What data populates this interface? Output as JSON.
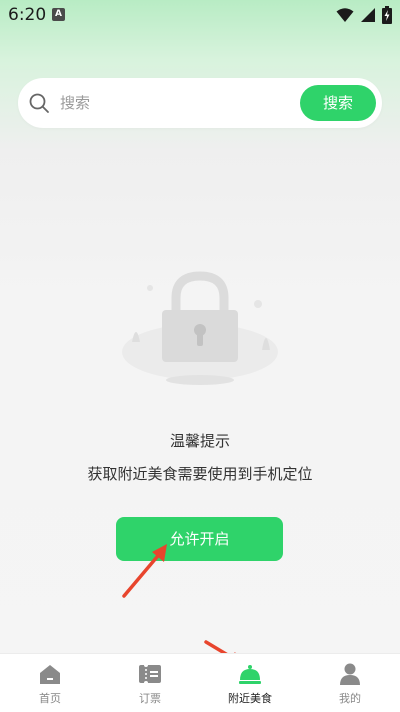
{
  "status_bar": {
    "time": "6:20",
    "notification_icon": "A"
  },
  "search": {
    "placeholder": "搜索",
    "button_label": "搜索"
  },
  "notice": {
    "title": "温馨提示",
    "description": "获取附近美食需要使用到手机定位",
    "button_label": "允许开启"
  },
  "tabs": [
    {
      "label": "首页",
      "icon": "home-icon"
    },
    {
      "label": "订票",
      "icon": "ticket-icon"
    },
    {
      "label": "附近美食",
      "icon": "food-bell-icon",
      "active": true
    },
    {
      "label": "我的",
      "icon": "profile-icon"
    }
  ],
  "colors": {
    "accent": "#2fd36a",
    "arrow": "#e8452d"
  }
}
